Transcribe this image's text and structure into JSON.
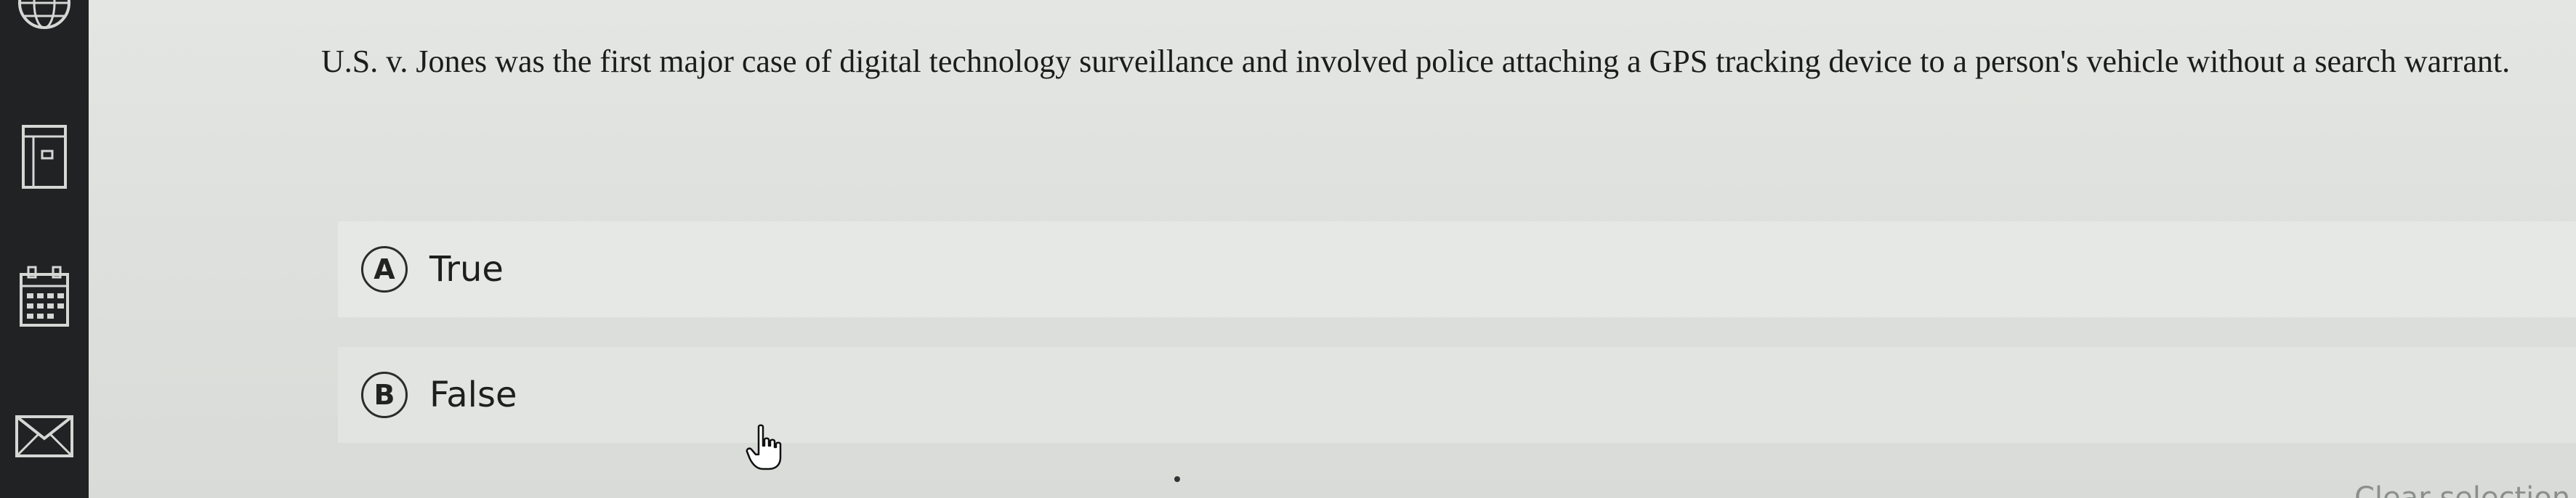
{
  "question": {
    "text": "U.S. v. Jones was the first major case of digital technology surveillance and involved police attaching a GPS tracking device to a person's vehicle without a search warrant."
  },
  "choices": [
    {
      "letter": "A",
      "label": "True"
    },
    {
      "letter": "B",
      "label": "False"
    }
  ],
  "sidebar": {
    "icons": [
      "globe-icon",
      "document-icon",
      "calendar-icon",
      "mail-icon"
    ]
  },
  "corner": {
    "text": "Clear selection"
  },
  "colors": {
    "rail": "#202223",
    "background": "#dfe1de",
    "text": "#1c1c1c"
  }
}
